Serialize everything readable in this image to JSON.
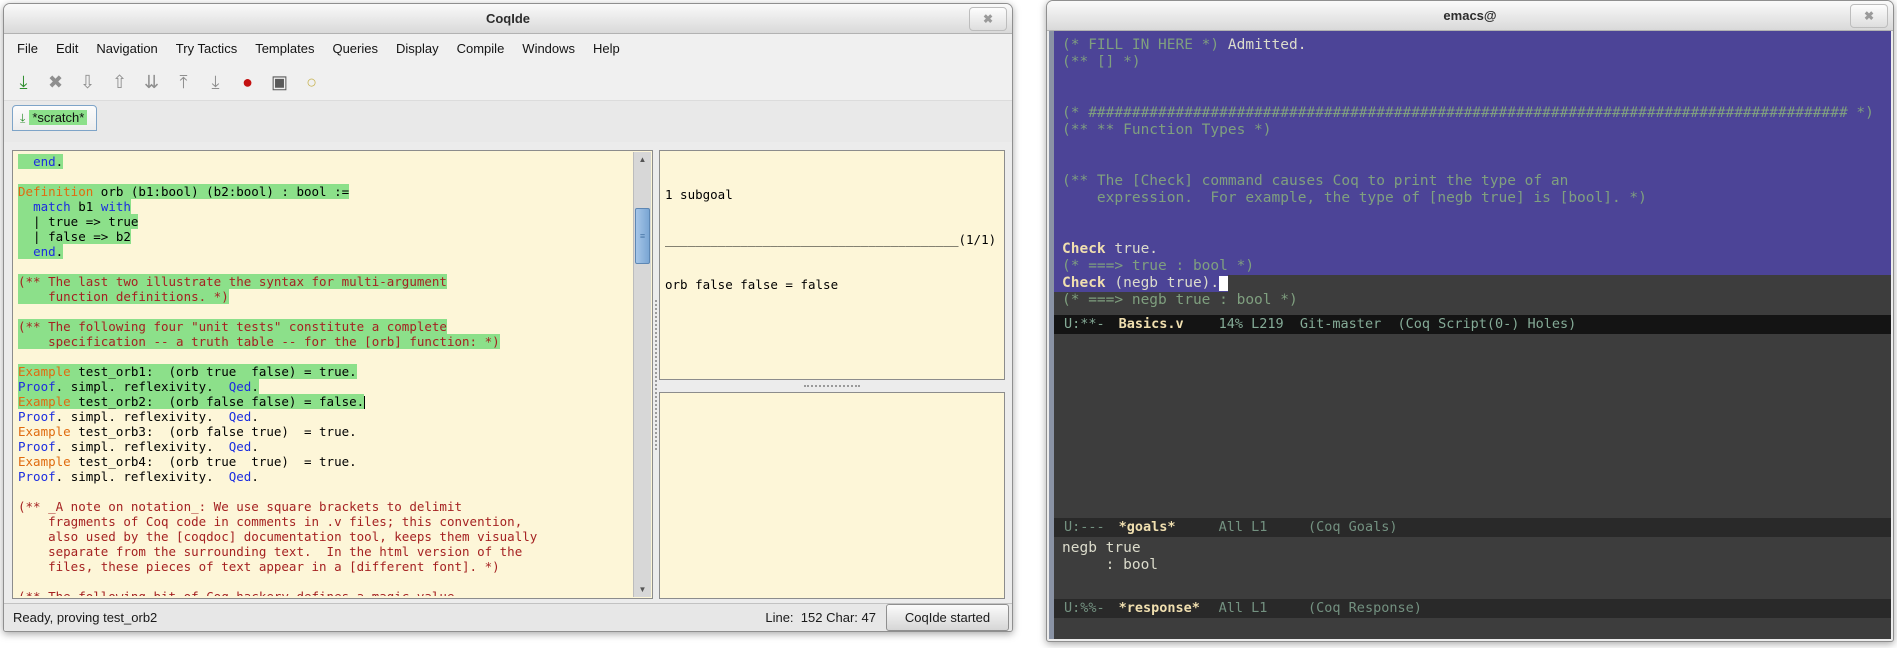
{
  "coqide": {
    "title": "CoqIde",
    "close_icon": "✖",
    "menus": [
      "File",
      "Edit",
      "Navigation",
      "Try Tactics",
      "Templates",
      "Queries",
      "Display",
      "Compile",
      "Windows",
      "Help"
    ],
    "toolbar": [
      {
        "name": "save-icon",
        "glyph": "⤓",
        "color": "#2f8f2f"
      },
      {
        "name": "close-icon",
        "glyph": "✖",
        "color": "#8f8f8f"
      },
      {
        "name": "step-forward-icon",
        "glyph": "⇩",
        "color": "#8f8f8f"
      },
      {
        "name": "step-backward-icon",
        "glyph": "⇧",
        "color": "#8f8f8f"
      },
      {
        "name": "run-to-cursor-icon",
        "glyph": "⇊",
        "color": "#8f8f8f"
      },
      {
        "name": "restart-icon",
        "glyph": "⤒",
        "color": "#8f8f8f"
      },
      {
        "name": "run-to-end-icon",
        "glyph": "⤓",
        "color": "#8f8f8f"
      },
      {
        "name": "interrupt-icon",
        "glyph": "●",
        "color": "#c41111"
      },
      {
        "name": "hide-goals-icon",
        "glyph": "▣",
        "color": "#5a5a5a"
      },
      {
        "name": "about-icon",
        "glyph": "○",
        "color": "#c8b454"
      }
    ],
    "tab": {
      "icon": "⤓",
      "label": "*scratch*"
    },
    "scrollbar": {
      "up": "▲",
      "down": "▼",
      "grip": "≡"
    },
    "editor_lines": [
      {
        "hl": true,
        "segs": [
          {
            "c": "p",
            "t": "  "
          },
          {
            "c": "kb",
            "t": "end"
          },
          {
            "c": "p",
            "t": "."
          }
        ]
      },
      {
        "segs": []
      },
      {
        "hl": true,
        "segs": [
          {
            "c": "kw",
            "t": "Definition"
          },
          {
            "c": "p",
            "t": " orb (b1:bool) (b2:bool) : bool :="
          }
        ]
      },
      {
        "hl": true,
        "segs": [
          {
            "c": "p",
            "t": "  "
          },
          {
            "c": "kb",
            "t": "match"
          },
          {
            "c": "p",
            "t": " b1 "
          },
          {
            "c": "kb",
            "t": "with"
          }
        ]
      },
      {
        "hl": true,
        "segs": [
          {
            "c": "p",
            "t": "  | true => true"
          }
        ]
      },
      {
        "hl": true,
        "segs": [
          {
            "c": "p",
            "t": "  | false => b2"
          }
        ]
      },
      {
        "hl": true,
        "segs": [
          {
            "c": "p",
            "t": "  "
          },
          {
            "c": "kb",
            "t": "end"
          },
          {
            "c": "p",
            "t": "."
          }
        ]
      },
      {
        "segs": []
      },
      {
        "hl": true,
        "segs": [
          {
            "c": "cm",
            "t": "(** The last two illustrate the syntax for multi-argument"
          }
        ]
      },
      {
        "hl": true,
        "segs": [
          {
            "c": "cm",
            "t": "    function definitions. *)"
          }
        ]
      },
      {
        "segs": []
      },
      {
        "hl": true,
        "segs": [
          {
            "c": "cm",
            "t": "(** The following four \"unit tests\" constitute a complete"
          }
        ]
      },
      {
        "hl": true,
        "segs": [
          {
            "c": "cm",
            "t": "    specification -- a truth table -- for the [orb] function: *)"
          }
        ]
      },
      {
        "segs": []
      },
      {
        "hl": true,
        "segs": [
          {
            "c": "kw",
            "t": "Example"
          },
          {
            "c": "p",
            "t": " test_orb1:  (orb true  false) = true."
          }
        ]
      },
      {
        "hl": true,
        "segs": [
          {
            "c": "kb",
            "t": "Proof"
          },
          {
            "c": "p",
            "t": ". simpl. reflexivity.  "
          },
          {
            "c": "kb",
            "t": "Qed"
          },
          {
            "c": "p",
            "t": "."
          }
        ]
      },
      {
        "hl": true,
        "cursor": true,
        "segs": [
          {
            "c": "kw",
            "t": "Example"
          },
          {
            "c": "p",
            "t": " test_orb2:  (orb false false) = false."
          }
        ]
      },
      {
        "segs": [
          {
            "c": "kb",
            "t": "Proof"
          },
          {
            "c": "p",
            "t": ". simpl. reflexivity.  "
          },
          {
            "c": "kb",
            "t": "Qed"
          },
          {
            "c": "p",
            "t": "."
          }
        ]
      },
      {
        "segs": [
          {
            "c": "kw",
            "t": "Example"
          },
          {
            "c": "p",
            "t": " test_orb3:  (orb false true)  = true."
          }
        ]
      },
      {
        "segs": [
          {
            "c": "kb",
            "t": "Proof"
          },
          {
            "c": "p",
            "t": ". simpl. reflexivity.  "
          },
          {
            "c": "kb",
            "t": "Qed"
          },
          {
            "c": "p",
            "t": "."
          }
        ]
      },
      {
        "segs": [
          {
            "c": "kw",
            "t": "Example"
          },
          {
            "c": "p",
            "t": " test_orb4:  (orb true  true)  = true."
          }
        ]
      },
      {
        "segs": [
          {
            "c": "kb",
            "t": "Proof"
          },
          {
            "c": "p",
            "t": ". simpl. reflexivity.  "
          },
          {
            "c": "kb",
            "t": "Qed"
          },
          {
            "c": "p",
            "t": "."
          }
        ]
      },
      {
        "segs": []
      },
      {
        "segs": [
          {
            "c": "cm",
            "t": "(** _A note on notation_: We use square brackets to delimit"
          }
        ]
      },
      {
        "segs": [
          {
            "c": "cm",
            "t": "    fragments of Coq code in comments in .v files; this convention,"
          }
        ]
      },
      {
        "segs": [
          {
            "c": "cm",
            "t": "    also used by the [coqdoc] documentation tool, keeps them visually"
          }
        ]
      },
      {
        "segs": [
          {
            "c": "cm",
            "t": "    separate from the surrounding text.  In the html version of the"
          }
        ]
      },
      {
        "segs": [
          {
            "c": "cm",
            "t": "    files, these pieces of text appear in a [different font]. *)"
          }
        ]
      },
      {
        "segs": []
      },
      {
        "segs": [
          {
            "c": "cm",
            "t": "(** The following bit of Coq hackery defines a magic value"
          }
        ]
      }
    ],
    "goals": {
      "header": "1 subgoal",
      "rule": "_______________________________________",
      "counter": "(1/1)",
      "goal": "orb false false = false"
    },
    "statusbar": {
      "status": "Ready, proving test_orb2",
      "line_label": "Line:",
      "line_value": "152",
      "char_label": "Char:",
      "char_value": "47",
      "button": "CoqIde started"
    }
  },
  "emacs": {
    "title": "emacs@",
    "close_icon": "✖",
    "buffer_lines": [
      {
        "bg": "full",
        "segs": [
          {
            "c": "cm",
            "t": "(* FILL IN HERE *) "
          },
          {
            "c": "pl",
            "t": "Admitted."
          }
        ]
      },
      {
        "bg": "full",
        "segs": [
          {
            "c": "cm",
            "t": "(** [] *)"
          }
        ]
      },
      {
        "bg": "full",
        "segs": []
      },
      {
        "bg": "full",
        "segs": []
      },
      {
        "bg": "full",
        "segs": [
          {
            "c": "cm",
            "t": "(* ####################################################################################### *)"
          }
        ]
      },
      {
        "bg": "full",
        "segs": [
          {
            "c": "cm",
            "t": "(** ** Function Types *)"
          }
        ]
      },
      {
        "bg": "full",
        "segs": []
      },
      {
        "bg": "full",
        "segs": []
      },
      {
        "bg": "full",
        "segs": [
          {
            "c": "cm",
            "t": "(** The [Check] command causes Coq to print the type of an"
          }
        ]
      },
      {
        "bg": "full",
        "segs": [
          {
            "c": "cm",
            "t": "    expression.  For example, the type of [negb true] is [bool]. *)"
          }
        ]
      },
      {
        "bg": "full",
        "segs": []
      },
      {
        "bg": "full",
        "segs": []
      },
      {
        "bg": "full",
        "segs": [
          {
            "c": "kw",
            "t": "Check"
          },
          {
            "c": "pl",
            "t": " true."
          }
        ]
      },
      {
        "bg": "full",
        "segs": [
          {
            "c": "cm",
            "t": "(* ===> true : bool *)"
          }
        ]
      },
      {
        "bg": "text",
        "cursor": true,
        "segs": [
          {
            "c": "kw",
            "t": "Check"
          },
          {
            "c": "pl",
            "t": " (negb true)."
          }
        ]
      },
      {
        "arrow": true,
        "segs": [
          {
            "c": "cm",
            "t": "(* ===> negb true : bool *)"
          }
        ]
      }
    ],
    "fringe_arrow": "▸",
    "modeline_main": {
      "prefix": "U:**-",
      "buffer": "Basics.v",
      "info": "14% L219  Git-master  (Coq Script(0-) Holes)"
    },
    "modeline_goals": {
      "prefix": "U:---",
      "buffer": "*goals*",
      "info": "All L1     (Coq Goals)"
    },
    "response_lines": [
      "negb true",
      "     : bool"
    ],
    "modeline_response": {
      "prefix": "U:%%-",
      "buffer": "*response*",
      "info": "All L1     (Coq Response)"
    }
  }
}
